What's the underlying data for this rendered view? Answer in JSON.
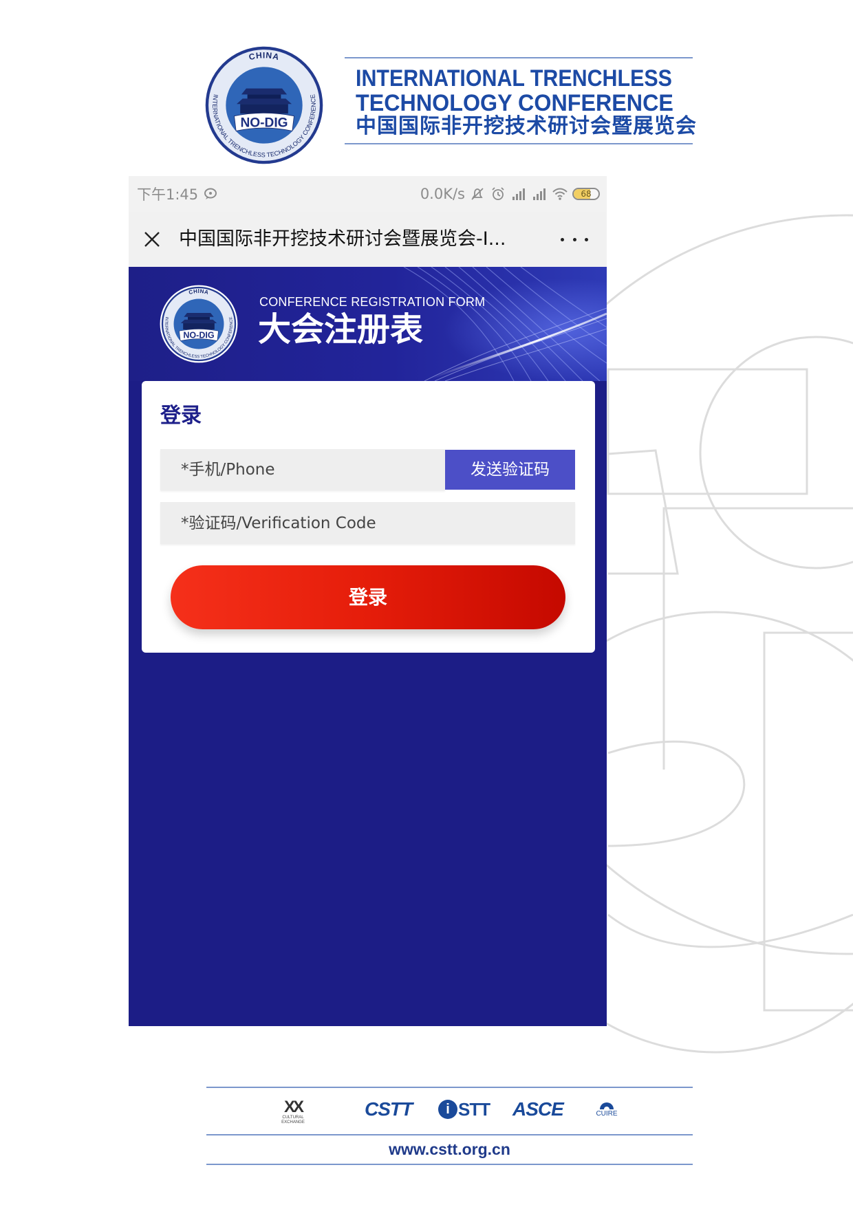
{
  "conference_header": {
    "logo": {
      "top_text": "CHINA",
      "center_text": "NO-DIG",
      "ring_text": "INTERNATIONAL TRENCHLESS TECHNOLOGY CONFERENCE"
    },
    "title_en_line1": "INTERNATIONAL TRENCHLESS",
    "title_en_line2": "TECHNOLOGY CONFERENCE",
    "title_cn": "中国国际非开挖技术研讨会暨展览会"
  },
  "phone": {
    "status_bar": {
      "time": "下午1:45",
      "net_speed": "0.0K/s",
      "battery_level": "68",
      "icons": [
        "chat-bubble-icon",
        "alarm-off-icon",
        "alarm-clock-icon",
        "signal-icon",
        "signal-icon",
        "wifi-icon",
        "battery-icon"
      ]
    },
    "title_bar": {
      "title": "中国国际非开挖技术研讨会暨展览会-I...",
      "close_icon": "close-icon",
      "more_icon": "more-icon"
    },
    "banner": {
      "subtitle_en": "CONFERENCE REGISTRATION FORM",
      "title_cn": "大会注册表"
    },
    "login_card": {
      "heading": "登录",
      "phone_placeholder": "*手机/Phone",
      "send_code_button": "发送验证码",
      "code_placeholder": "*验证码/Verification Code",
      "submit_button": "登录"
    }
  },
  "footer": {
    "partners": [
      {
        "name": "XX",
        "caption": "CULTURAL EXCHANGE"
      },
      {
        "name": "CSTT"
      },
      {
        "badge": "i",
        "name": "STT"
      },
      {
        "name": "ASCE"
      },
      {
        "name": "CUIRE"
      }
    ],
    "url": "www.cstt.org.cn"
  },
  "colors": {
    "brand_blue": "#1c1d86",
    "title_blue": "#1c4aa5",
    "send_code_button": "#4c4fc7",
    "login_button": "#e51d0a",
    "status_bar_bg": "#f2f2f2",
    "decor_outline": "#dcdcdc"
  }
}
